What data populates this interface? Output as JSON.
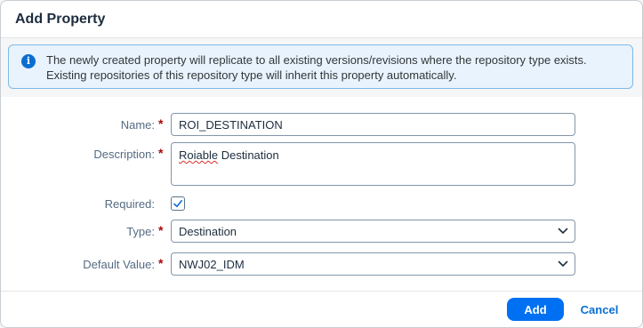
{
  "dialog": {
    "title": "Add Property",
    "info_message": "The newly created property will replicate to all existing versions/revisions where the repository type exists. Existing repositories of this repository type will inherit this property automatically.",
    "info_icon": "info-icon"
  },
  "form": {
    "required_marker": "*",
    "name": {
      "label": "Name:",
      "value": "ROI_DESTINATION",
      "required": true
    },
    "description": {
      "label": "Description:",
      "value_word1": "Roiable",
      "value_rest": " Destination",
      "required": true
    },
    "required_field": {
      "label": "Required:",
      "checked": true
    },
    "type": {
      "label": "Type:",
      "value": "Destination",
      "required": true,
      "icon": "chevron-down-icon"
    },
    "default_value": {
      "label": "Default Value:",
      "value": "NWJ02_IDM",
      "required": true,
      "icon": "chevron-down-icon"
    }
  },
  "footer": {
    "add_label": "Add",
    "cancel_label": "Cancel"
  },
  "colors": {
    "accent": "#0070f2",
    "link": "#0a6ed1",
    "required": "#aa0808",
    "info_bg": "#e8f3fd"
  }
}
